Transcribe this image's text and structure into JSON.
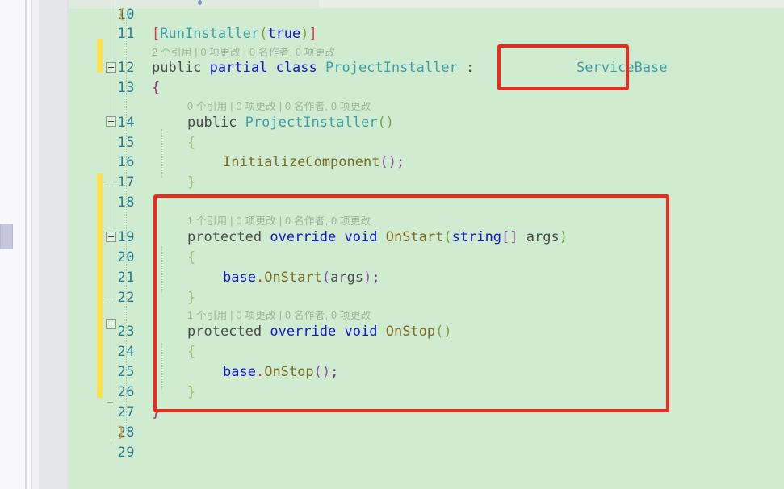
{
  "app": {
    "name": "visual-studio-code-editor",
    "language": "csharp",
    "theme_background": "#cfecd0",
    "accent_annotation": "#ee2a1e",
    "changebar_color": "#ffe14d",
    "lineno_color": "#2b7a8c"
  },
  "gutter": {
    "line_numbers": [
      "10",
      "11",
      "12",
      "13",
      "14",
      "15",
      "16",
      "17",
      "18",
      "19",
      "20",
      "21",
      "22",
      "23",
      "24",
      "25",
      "26",
      "27",
      "28",
      "29"
    ],
    "fold_markers": [
      "12",
      "14",
      "19",
      "23"
    ],
    "change_bar_lines": [
      "11-12",
      "17-26"
    ]
  },
  "codelens": [
    {
      "id": "class",
      "text": "2 个引用 | 0 项更改 | 0 名作者, 0 项更改"
    },
    {
      "id": "ctor",
      "text": "0 个引用 | 0 项更改 | 0 名作者, 0 项更改"
    },
    {
      "id": "onstart",
      "text": "1 个引用 | 0 项更改 | 0 名作者, 0 项更改"
    },
    {
      "id": "onstop",
      "text": "1 个引用 | 0 项更改 | 0 名作者, 0 项更改"
    }
  ],
  "code": {
    "l10_brace": "{",
    "l11_attr_open": "[",
    "l11_attr_name": "RunInstaller",
    "l11_paren_open": "(",
    "l11_true": "true",
    "l11_paren_close": ")",
    "l11_attr_close": "]",
    "l12_public": "public",
    "l12_partial": "partial",
    "l12_class": "class",
    "l12_name": "ProjectInstaller",
    "l12_colon": ":",
    "l12_base": "ServiceBase",
    "l13_brace": "{",
    "l14_public": "public",
    "l14_ctor": "ProjectInstaller",
    "l14_parens": "()",
    "l15_brace": "{",
    "l16_call": "InitializeComponent",
    "l16_parens": "()",
    "l16_semi": ";",
    "l17_brace": "}",
    "l19_protected": "protected",
    "l19_override": "override",
    "l19_void": "void",
    "l19_name": "OnStart",
    "l19_paren_open": "(",
    "l19_string": "string",
    "l19_sqb": "[]",
    "l19_args": "args",
    "l19_paren_close": ")",
    "l20_brace": "{",
    "l21_base": "base",
    "l21_dot": ".",
    "l21_name": "OnStart",
    "l21_paren_open": "(",
    "l21_args": "args",
    "l21_paren_close": ")",
    "l21_semi": ";",
    "l22_brace": "}",
    "l23_protected": "protected",
    "l23_override": "override",
    "l23_void": "void",
    "l23_name": "OnStop",
    "l23_parens": "()",
    "l24_brace": "{",
    "l25_base": "base",
    "l25_dot": ".",
    "l25_name": "OnStop",
    "l25_parens": "()",
    "l25_semi": ";",
    "l26_brace": "}",
    "l27_brace": "}",
    "l28_brace": "}"
  },
  "annotations": [
    {
      "id": "servicebase-highlight",
      "label": "ServiceBase base-class highlight"
    },
    {
      "id": "overrides-highlight",
      "label": "OnStart / OnStop overrides highlight"
    }
  ]
}
